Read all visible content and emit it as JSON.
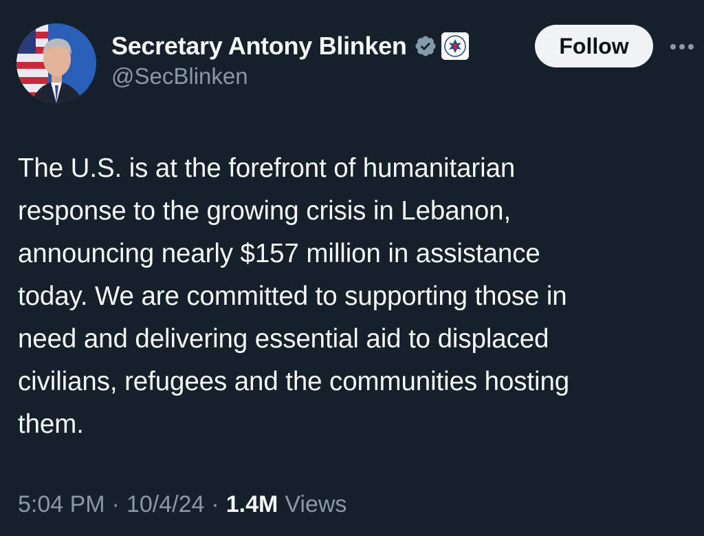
{
  "author": {
    "display_name": "Secretary Antony Blinken",
    "handle": "@SecBlinken",
    "verified_icon": "verified-badge-icon",
    "affiliate_icon": "state-department-seal-icon"
  },
  "actions": {
    "follow_label": "Follow",
    "more_icon": "more-horizontal-icon"
  },
  "tweet": {
    "text": "The U.S. is at the forefront of humanitarian\nresponse to the growing crisis in Lebanon,\nannouncing nearly $157 million in assistance\ntoday. We are committed to supporting those in\nneed and delivering essential aid to displaced\ncivilians, refugees and the communities hosting\nthem."
  },
  "meta": {
    "time": "5:04 PM",
    "separator": "·",
    "date": "10/4/24",
    "views_count": "1.4M",
    "views_label": "Views"
  },
  "colors": {
    "background": "#15202b",
    "primary_text": "#f7f9f9",
    "secondary_text": "#8b98a5",
    "follow_button_bg": "#eff3f4",
    "verified_badge": "#829aab"
  }
}
